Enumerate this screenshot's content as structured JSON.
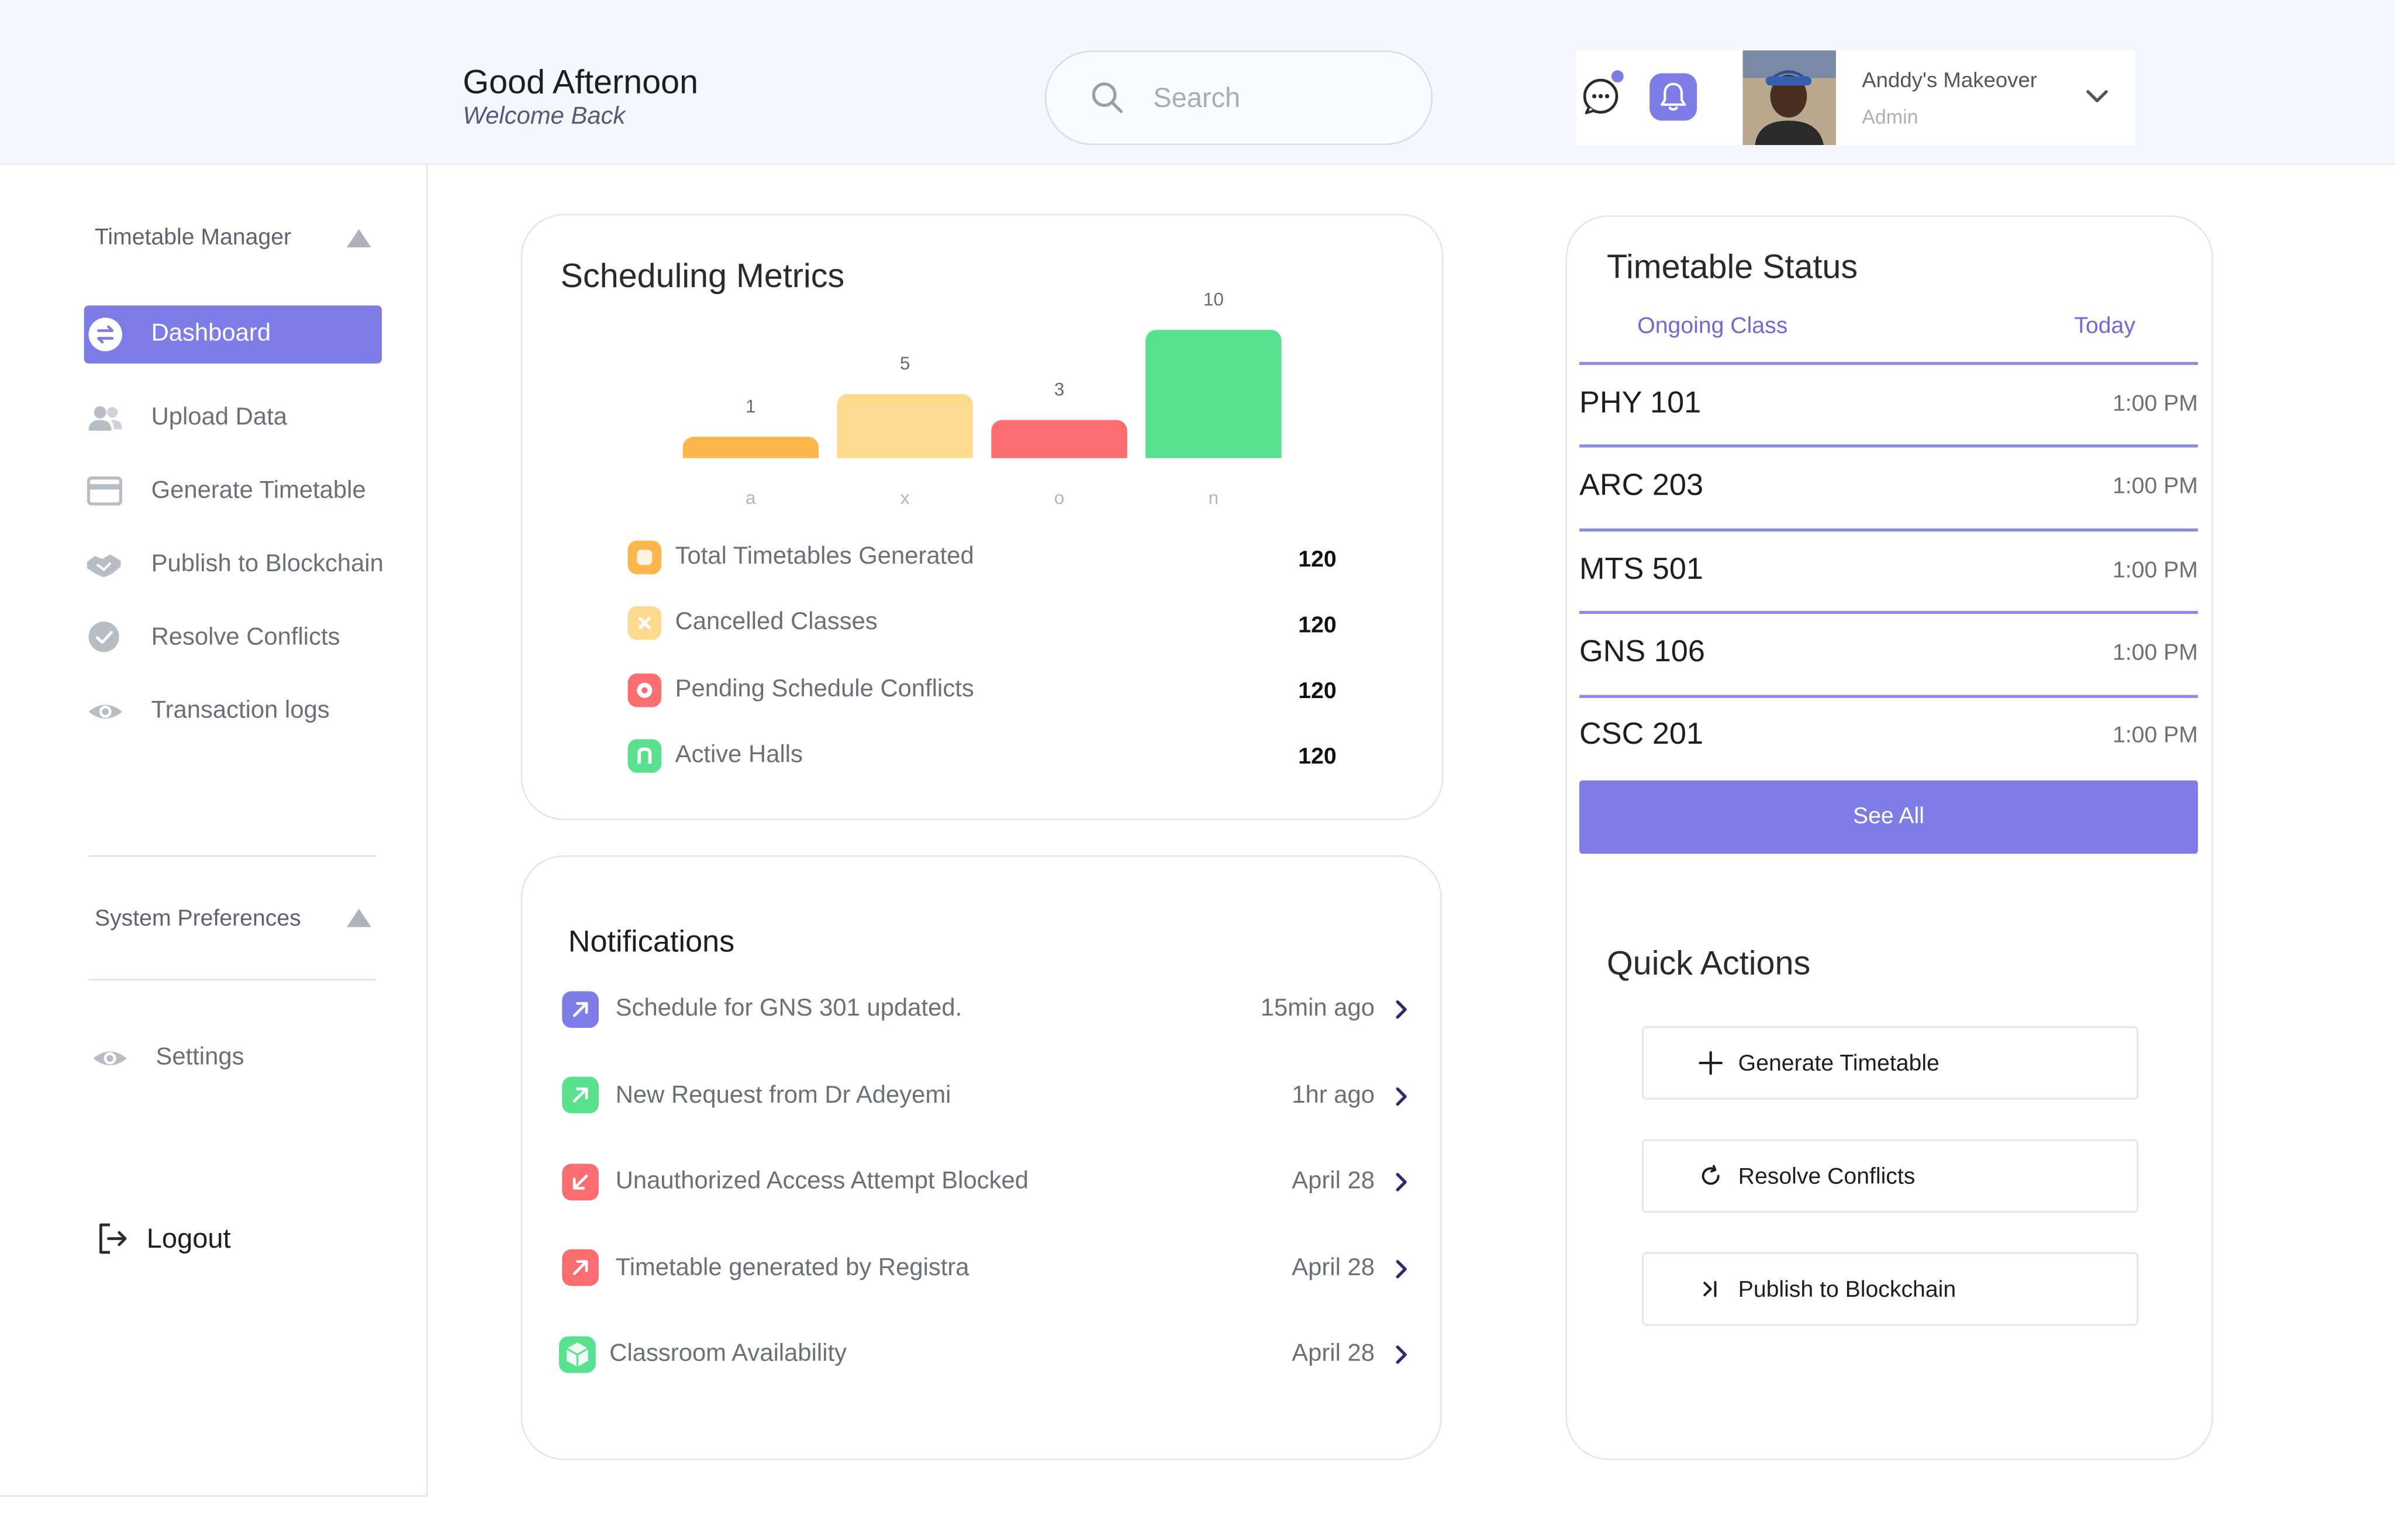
{
  "header": {
    "greeting": "Good Afternoon",
    "subtitle": "Welcome Back",
    "search_placeholder": "Search",
    "user_name": "Anddy's Makeover",
    "user_role": "Admin"
  },
  "sidebar": {
    "section_title": "Timetable Manager",
    "items": [
      {
        "label": "Dashboard",
        "icon": "swap-icon",
        "active": true
      },
      {
        "label": "Upload Data",
        "icon": "users-icon"
      },
      {
        "label": "Generate Timetable",
        "icon": "card-icon"
      },
      {
        "label": "Publish to Blockchain",
        "icon": "handshake-icon"
      },
      {
        "label": "Resolve Conflicts",
        "icon": "check-circle-icon"
      },
      {
        "label": "Transaction logs",
        "icon": "eye-icon"
      }
    ],
    "preferences_title": "System Preferences",
    "settings_label": "Settings",
    "logout_label": "Logout"
  },
  "metrics": {
    "title": "Scheduling Metrics",
    "legend": [
      {
        "label": "Total Timetables Generated",
        "value": "120",
        "color": "#fdb64c"
      },
      {
        "label": "Cancelled Classes",
        "value": "120",
        "color": "#fed98e"
      },
      {
        "label": "Pending Schedule Conflicts",
        "value": "120",
        "color": "#fc6d70"
      },
      {
        "label": "Active Halls",
        "value": "120",
        "color": "#5ae18f"
      }
    ]
  },
  "chart_data": {
    "type": "bar",
    "categories": [
      "a",
      "x",
      "o",
      "n"
    ],
    "values": [
      1,
      5,
      3,
      10
    ],
    "data_labels": [
      "1",
      "5",
      "3",
      "10"
    ],
    "colors": [
      "#fdb64c",
      "#fed98e",
      "#fc6d70",
      "#5ae18f"
    ],
    "title": "",
    "xlabel": "",
    "ylabel": "",
    "grid": false
  },
  "notifications": {
    "title": "Notifications",
    "items": [
      {
        "text": "Schedule for GNS 301 updated.",
        "time": "15min ago",
        "color": "#7e7ce6",
        "icon": "arrow-up-right-icon"
      },
      {
        "text": "New Request from Dr Adeyemi",
        "time": "1hr ago",
        "color": "#5ae18f",
        "icon": "arrow-up-right-icon"
      },
      {
        "text": "Unauthorized Access Attempt Blocked",
        "time": "April 28",
        "color": "#fc6d70",
        "icon": "arrow-down-left-icon"
      },
      {
        "text": "Timetable generated by Registra",
        "time": "April 28",
        "color": "#fc6d70",
        "icon": "arrow-up-right-icon"
      },
      {
        "text": "Classroom Availability",
        "time": "April 28",
        "color": "#5ae18f",
        "icon": "cube-icon"
      }
    ]
  },
  "timetable_status": {
    "title": "Timetable Status",
    "col_class": "Ongoing Class",
    "col_today": "Today",
    "rows": [
      {
        "code": "PHY 101",
        "time": "1:00 PM"
      },
      {
        "code": "ARC 203",
        "time": "1:00 PM"
      },
      {
        "code": "MTS 501",
        "time": "1:00 PM"
      },
      {
        "code": "GNS 106",
        "time": "1:00 PM"
      },
      {
        "code": "CSC 201",
        "time": "1:00 PM"
      }
    ],
    "see_all": "See All"
  },
  "quick_actions": {
    "title": "Quick Actions",
    "items": [
      {
        "label": "Generate Timetable",
        "icon": "plus-icon"
      },
      {
        "label": "Resolve Conflicts",
        "icon": "refresh-icon"
      },
      {
        "label": "Publish to Blockchain",
        "icon": "skip-forward-icon"
      }
    ]
  },
  "colors": {
    "accent": "#7e7ce6",
    "accent_text": "#6d6bd4"
  }
}
